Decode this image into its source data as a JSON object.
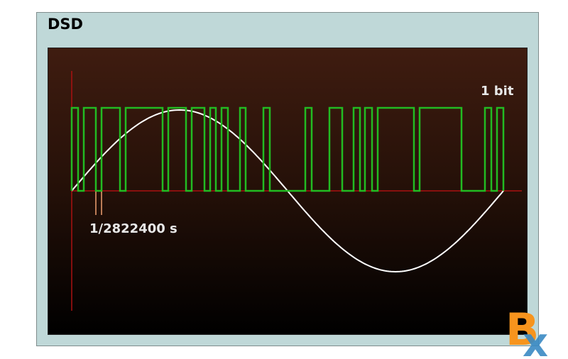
{
  "title": "DSD",
  "labels": {
    "bit": "1 bit",
    "sample_period": "1/2822400 s"
  },
  "logo": {
    "letters": "BX",
    "name": "logo-icon"
  },
  "colors": {
    "frame_bg": "#bfd8d8",
    "pulse": "#22bb22",
    "sine": "#ffffff",
    "axis": "#aa1111",
    "marker": "#f0a070",
    "logo_orange": "#f7941d",
    "logo_blue": "#3a8ac4"
  }
}
